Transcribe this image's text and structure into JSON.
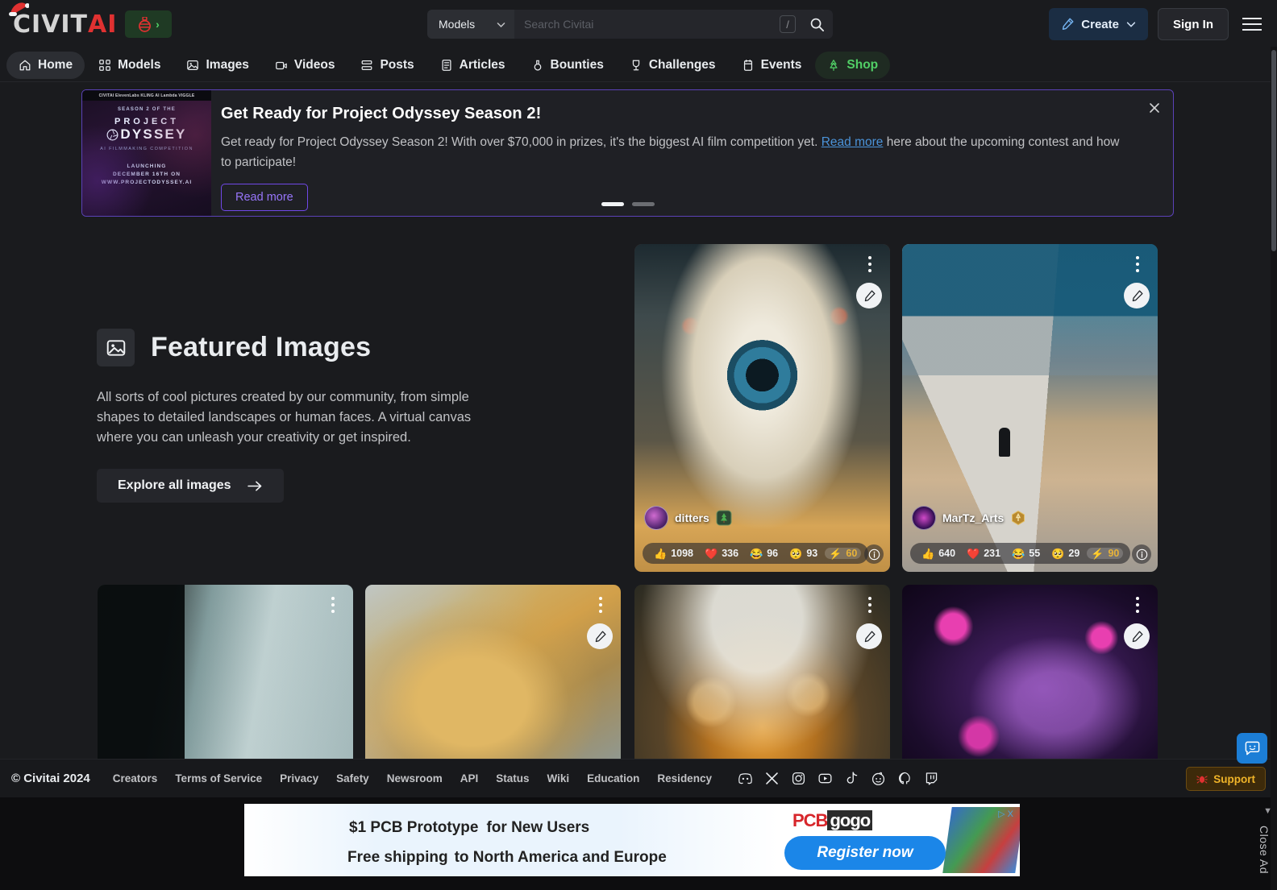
{
  "header": {
    "logo_civit": "CIVIT",
    "logo_ai": "AI",
    "holiday_button": "holiday-ornament-icon",
    "search": {
      "category": "Models",
      "placeholder": "Search Civitai",
      "value": "",
      "shortcut_key": "/",
      "search_icon": "search-icon"
    },
    "create_label": "Create",
    "signin_label": "Sign In",
    "menu_icon": "hamburger-menu-icon"
  },
  "nav": {
    "items": [
      {
        "label": "Home",
        "icon": "home-icon",
        "active": true
      },
      {
        "label": "Models",
        "icon": "grid-icon",
        "active": false
      },
      {
        "label": "Images",
        "icon": "image-icon",
        "active": false
      },
      {
        "label": "Videos",
        "icon": "video-icon",
        "active": false
      },
      {
        "label": "Posts",
        "icon": "posts-icon",
        "active": false
      },
      {
        "label": "Articles",
        "icon": "article-icon",
        "active": false
      },
      {
        "label": "Bounties",
        "icon": "bounty-icon",
        "active": false
      },
      {
        "label": "Challenges",
        "icon": "trophy-icon",
        "active": false
      },
      {
        "label": "Events",
        "icon": "calendar-icon",
        "active": false
      },
      {
        "label": "Shop",
        "icon": "tree-icon",
        "active": false,
        "shop": true
      }
    ]
  },
  "banner": {
    "title": "Get Ready for Project Odyssey Season 2!",
    "text_part1": "Get ready for Project Odyssey Season 2! With over $70,000 in prizes, it's the biggest AI film competition yet. ",
    "link_label": "Read more",
    "text_part2": " here about the upcoming contest and how to participate!",
    "button_label": "Read more",
    "close_icon": "close-icon",
    "thumbnail": {
      "sponsors": "CIVITAI  ElevenLabs  KLING AI  Lambda  VIGGLE",
      "line_season": "SEASON 2 OF THE",
      "line_project": "PROJECT",
      "line_odyssey": "DYSSEY",
      "line_sub": "AI FILMMAKING COMPETITION",
      "line_launch": "LAUNCHING\nDECEMBER 16TH ON\nWWW.PROJECTODYSSEY.AI"
    },
    "carousel": {
      "total": 2,
      "active_index": 0
    }
  },
  "featured": {
    "icon": "image-icon",
    "title": "Featured Images",
    "description": "All sorts of cool pictures created by our community, from simple shapes to detailed landscapes or human faces. A virtual canvas where you can unleash your creativity or get inspired.",
    "explore_label": "Explore all images",
    "explore_arrow": "arrow-right-icon"
  },
  "cards": [
    {
      "id": "card-eyeball",
      "user": "ditters",
      "badge": "christmas-tree-badge",
      "reactions": [
        {
          "emoji": "👍",
          "count": "1098",
          "name": "thumbs-up"
        },
        {
          "emoji": "❤️",
          "count": "336",
          "name": "heart"
        },
        {
          "emoji": "😂",
          "count": "96",
          "name": "laugh"
        },
        {
          "emoji": "🥺",
          "count": "93",
          "name": "cry"
        },
        {
          "emoji": "⚡",
          "count": "60",
          "name": "buzz",
          "highlight": true
        }
      ],
      "menu_icon": "more-vertical-icon",
      "remix_icon": "brush-icon",
      "info_icon": "info-icon"
    },
    {
      "id": "card-road",
      "user": "MarTz_Arts",
      "badge": "gold-rank-badge",
      "reactions": [
        {
          "emoji": "👍",
          "count": "640",
          "name": "thumbs-up"
        },
        {
          "emoji": "❤️",
          "count": "231",
          "name": "heart"
        },
        {
          "emoji": "😂",
          "count": "55",
          "name": "laugh"
        },
        {
          "emoji": "🥺",
          "count": "29",
          "name": "cry"
        },
        {
          "emoji": "⚡",
          "count": "90",
          "name": "buzz",
          "highlight": true
        }
      ],
      "menu_icon": "more-vertical-icon",
      "remix_icon": "brush-icon",
      "info_icon": "info-icon"
    },
    {
      "id": "card-chess",
      "menu_icon": "more-vertical-icon",
      "remix_icon": "brush-icon"
    },
    {
      "id": "card-lion",
      "menu_icon": "more-vertical-icon",
      "remix_icon": "brush-icon"
    },
    {
      "id": "card-blossom",
      "menu_icon": "more-vertical-icon",
      "remix_icon": "brush-icon"
    },
    {
      "id": "card-snake",
      "menu_icon": "more-vertical-icon",
      "remix_icon": "brush-icon"
    }
  ],
  "footer": {
    "copyright": "© Civitai 2024",
    "links": [
      "Creators",
      "Terms of Service",
      "Privacy",
      "Safety",
      "Newsroom",
      "API",
      "Status",
      "Wiki",
      "Education",
      "Residency"
    ],
    "socials": [
      "discord-icon",
      "x-icon",
      "instagram-icon",
      "youtube-icon",
      "tiktok-icon",
      "reddit-icon",
      "github-icon",
      "twitch-icon"
    ],
    "support_label": "Support",
    "support_icon": "bug-icon"
  },
  "ad": {
    "headline1": "$1 PCB Prototype",
    "headline1_sub": "for New Users",
    "headline2": "Free shipping",
    "headline2_sub": "to North America and Europe",
    "brand_pcb": "PCB",
    "brand_gogo": "gogo",
    "cta": "Register now",
    "adchoices": "▷ X",
    "close_label": "Close Ad"
  },
  "chat": {
    "icon": "chat-bubble-icon"
  },
  "colors": {
    "background": "#1a1b1e",
    "accent_purple": "#7048e8",
    "accent_blue": "#1c7ed6",
    "brand_red": "#e03131",
    "shop_green": "#51cf66",
    "buzz_gold": "#e8b339"
  }
}
